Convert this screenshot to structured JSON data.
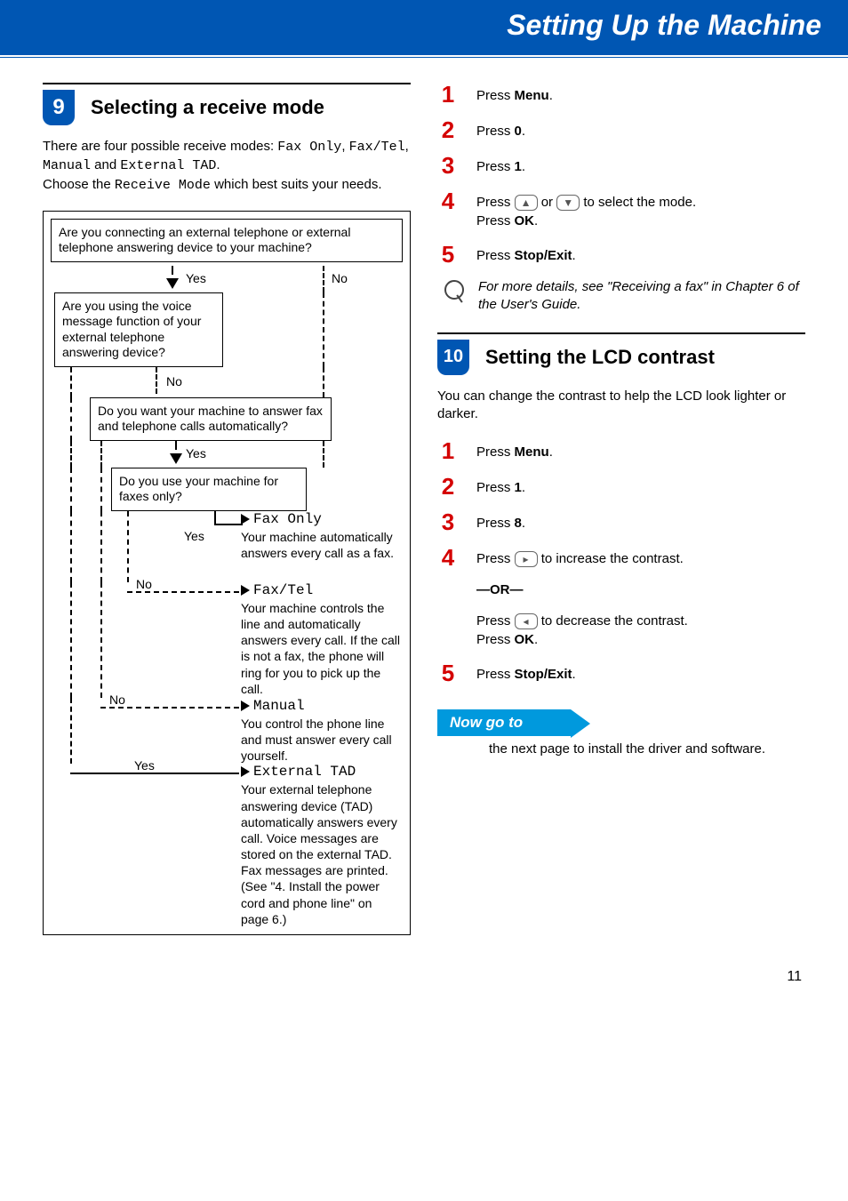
{
  "header": "Setting Up the Machine",
  "page_number": "11",
  "section9": {
    "number": "9",
    "title": "Selecting a receive mode",
    "intro_a": "There are four possible receive modes: ",
    "mode1": "Fax Only",
    "sep1": ", ",
    "mode2": "Fax/Tel",
    "sep2": ", ",
    "mode3": "Manual",
    "and": " and ",
    "mode4": "External TAD",
    "period": ".",
    "intro_b_a": "Choose the ",
    "intro_b_mono": "Receive Mode",
    "intro_b_c": " which best suits your needs.",
    "flow": {
      "q1": "Are you connecting an external telephone or external telephone answering device to your machine?",
      "yes": "Yes",
      "no": "No",
      "q2": "Are you using the voice message function of your external telephone answering device?",
      "q3": "Do you want your machine to answer fax and telephone calls automatically?",
      "q4": "Do you use your machine for faxes only?",
      "r_faxonly_name": "Fax Only",
      "r_faxonly_desc": "Your machine automatically answers every call as a fax.",
      "r_faxtel_name": "Fax/Tel",
      "r_faxtel_desc": "Your machine controls the line and automatically answers every call. If the call is not a fax, the phone will ring for you to pick up the call.",
      "r_manual_name": "Manual",
      "r_manual_desc": "You control the phone line and must answer every call yourself.",
      "r_ext_name": "External TAD",
      "r_ext_desc": "Your external telephone answering device (TAD) automatically answers every call. Voice messages are stored on the external TAD. Fax messages are printed. (See \"4. Install the power cord and phone line\" on page 6.)"
    }
  },
  "secA_steps": {
    "s1_a": "Press ",
    "s1_b": "Menu",
    "s1_c": ".",
    "s2_a": "Press ",
    "s2_b": "0",
    "s2_c": ".",
    "s3_a": "Press ",
    "s3_b": "1",
    "s3_c": ".",
    "s4_a": "Press ",
    "s4_or": " or ",
    "s4_b": " to select the mode.",
    "s4_c": "Press ",
    "s4_d": "OK",
    "s4_e": ".",
    "s5_a": "Press ",
    "s5_b": "Stop/Exit",
    "s5_c": "."
  },
  "note": "For more details, see \"Receiving a fax\" in Chapter 6 of the User's Guide.",
  "section10": {
    "number": "10",
    "title": "Setting the LCD contrast",
    "intro": "You can change the contrast to help the LCD look lighter or darker."
  },
  "secB_steps": {
    "s1_a": "Press ",
    "s1_b": "Menu",
    "s1_c": ".",
    "s2_a": "Press ",
    "s2_b": "1",
    "s2_c": ".",
    "s3_a": "Press ",
    "s3_b": "8",
    "s3_c": ".",
    "s4_a": "Press ",
    "s4_b": " to increase the contrast.",
    "s4_or": "—OR—",
    "s4_c": "Press ",
    "s4_d": " to decrease the contrast.",
    "s4_e": "Press ",
    "s4_f": "OK",
    "s4_g": ".",
    "s5_a": "Press ",
    "s5_b": "Stop/Exit",
    "s5_c": "."
  },
  "goto": {
    "label": "Now go to",
    "text": "the next page to install the driver and software."
  },
  "btn": {
    "up": "▲",
    "down": "▼",
    "left": "◂",
    "right": "▸"
  }
}
